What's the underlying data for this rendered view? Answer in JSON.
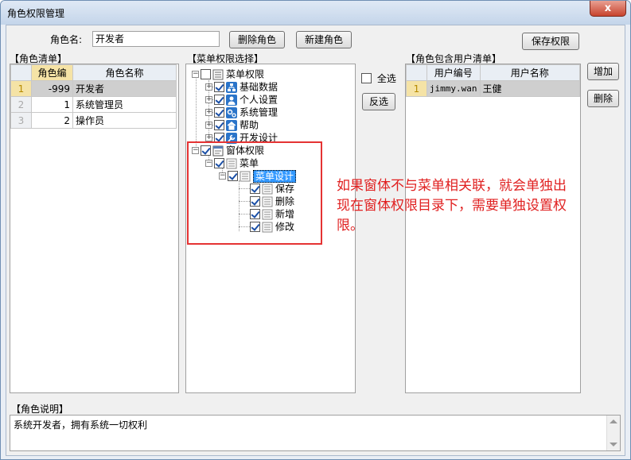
{
  "window": {
    "title": "角色权限管理",
    "close": "x"
  },
  "form": {
    "role_name_label": "角色名:",
    "role_name_value": "开发者",
    "delete_role": "删除角色",
    "new_role": "新建角色",
    "save_perm": "保存权限"
  },
  "role_list": {
    "title": "【角色清单】",
    "headers": [
      "角色编",
      "角色名称"
    ],
    "rows": [
      {
        "n": "1",
        "id": "-999",
        "name": "开发者"
      },
      {
        "n": "2",
        "id": "1",
        "name": "系统管理员"
      },
      {
        "n": "3",
        "id": "2",
        "name": "操作员"
      }
    ]
  },
  "menu_tree": {
    "title": "【菜单权限选择】",
    "nodes": [
      {
        "label": "菜单权限",
        "icon": "menu-icon"
      },
      {
        "label": "基础数据",
        "icon": "org-chart-icon"
      },
      {
        "label": "个人设置",
        "icon": "user-icon"
      },
      {
        "label": "系统管理",
        "icon": "gears-icon"
      },
      {
        "label": "帮助",
        "icon": "home-icon"
      },
      {
        "label": "开发设计",
        "icon": "wrench-icon"
      },
      {
        "label": "窗体权限",
        "icon": "window-icon"
      },
      {
        "label": "菜单",
        "icon": "list-icon"
      },
      {
        "label": "菜单设计",
        "icon": "list-icon"
      },
      {
        "label": "保存",
        "icon": "list-icon"
      },
      {
        "label": "删除",
        "icon": "list-icon"
      },
      {
        "label": "新增",
        "icon": "list-icon"
      },
      {
        "label": "修改",
        "icon": "list-icon"
      }
    ]
  },
  "select_all": "全选",
  "invert": "反选",
  "users": {
    "title": "【角色包含用户清单】",
    "headers": [
      "用户编号",
      "用户名称"
    ],
    "rows": [
      {
        "n": "1",
        "code": "jimmy.wan",
        "name": "王健"
      }
    ]
  },
  "add": "增加",
  "remove": "删除",
  "annotation": [
    "如果窗体不与菜单相关联，就会单独出",
    "现在窗体权限目录下，需要单独设置权",
    "限。"
  ],
  "description": {
    "title": "【角色说明】",
    "text": "系统开发者，拥有系统一切权利"
  },
  "colors": {
    "annotation": "#e02020",
    "selection": "#3399ff"
  }
}
